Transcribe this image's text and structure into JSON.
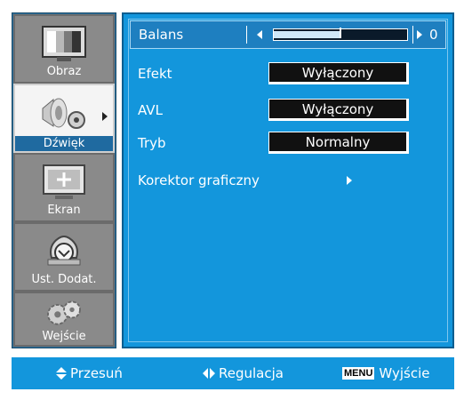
{
  "categories": [
    {
      "label": "Obraz",
      "icon": "tv-picture-icon",
      "active": false
    },
    {
      "label": "Dźwięk",
      "icon": "speaker-icon",
      "active": true
    },
    {
      "label": "Ekran",
      "icon": "screen-icon",
      "active": false
    },
    {
      "label": "Ust. Dodat.",
      "icon": "extra-settings-icon",
      "active": false
    },
    {
      "label": "Wejście",
      "icon": "gears-icon",
      "active": false
    }
  ],
  "settings": {
    "balance": {
      "label": "Balans",
      "value": "0",
      "level": 0
    },
    "effect": {
      "label": "Efekt",
      "value": "Wyłączony"
    },
    "avl": {
      "label": "AVL",
      "value": "Wyłączony"
    },
    "mode": {
      "label": "Tryb",
      "value": "Normalny"
    },
    "equalizer": {
      "label": "Korektor graficzny"
    }
  },
  "hints": {
    "move": "Przesuń",
    "adjust": "Regulacja",
    "menu_key": "MENU",
    "exit": "Wyjście"
  },
  "colors": {
    "panel": "#1396dc",
    "highlight_row": "#1e7fc0",
    "active_category": "#1f6aa0",
    "value_box": "#111111"
  }
}
